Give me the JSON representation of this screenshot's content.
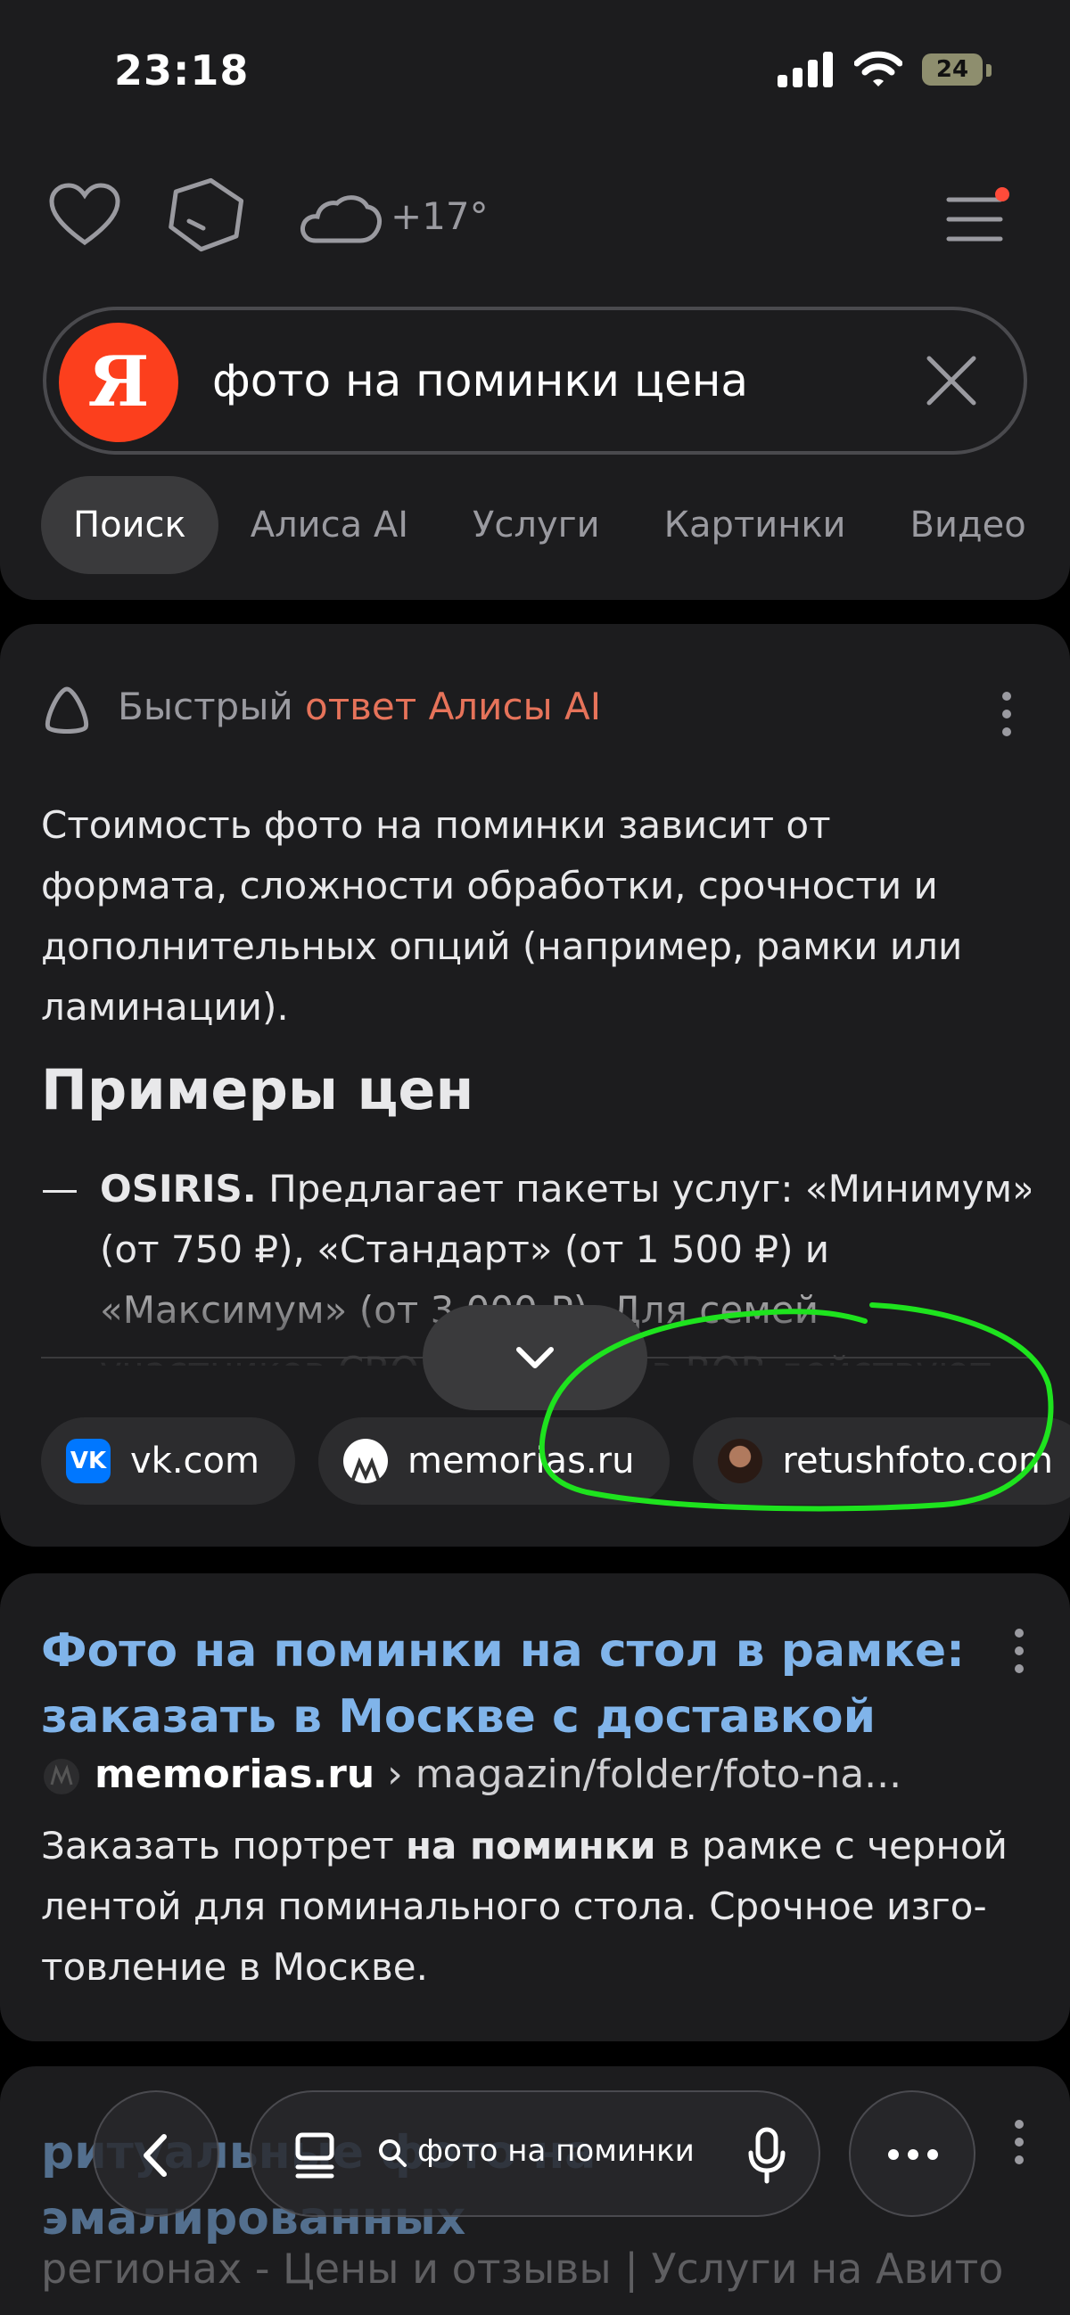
{
  "status_bar": {
    "time": "23:18",
    "battery": "24"
  },
  "header": {
    "temperature": "+17°"
  },
  "search": {
    "query": "фото на поминки цена",
    "logo": "Я"
  },
  "tabs": [
    "Поиск",
    "Алиса AI",
    "Услуги",
    "Картинки",
    "Видео"
  ],
  "answer": {
    "label_prefix": "Быстрый ",
    "label_accent": "ответ Алисы AI",
    "body": "Стоимость фото на поминки зависит от формата, сложности обработки, срочности и дополнительных опций (например, рамки или ламинации).",
    "examples_title": "Примеры цен",
    "example_dash": "—",
    "example_name": "OSIRIS.",
    "example_text": " Предлагает пакеты услуг: «Минимум» (от 750 ₽), «Стандарт» (от 1 500 ₽) и «Максимум» (от 3 000 ₽). Для семей участников СВО и ветеранов ВОВ действуют скидки.",
    "sources": [
      "vk.com",
      "memorias.ru",
      "retushfoto.com"
    ],
    "vk_icon": "VK"
  },
  "result": {
    "title": "Фото на поминки на стол в рамке: заказать в Москве с доставкой",
    "domain": "memorias.ru",
    "path": " › magazin/folder/foto-na...",
    "snippet_before": "Заказать портрет ",
    "snippet_bold": "на поминки",
    "snippet_after": " в рамке с черной лентой для поминального стола. Срочное изго­товление в Москве."
  },
  "next_result": {
    "title": "ритуальные фото на эмалированных",
    "subtitle": "регионах - Цены и отзывы | Услуги на Авито | Поиск специалистов"
  },
  "bottom_bar": {
    "query": "фото на поминки"
  },
  "colors": {
    "accent_link": "#80b4ea",
    "yandex_red": "#fc3f1d",
    "alice_accent": "#e6735a",
    "annotation": "#1ee31e"
  }
}
